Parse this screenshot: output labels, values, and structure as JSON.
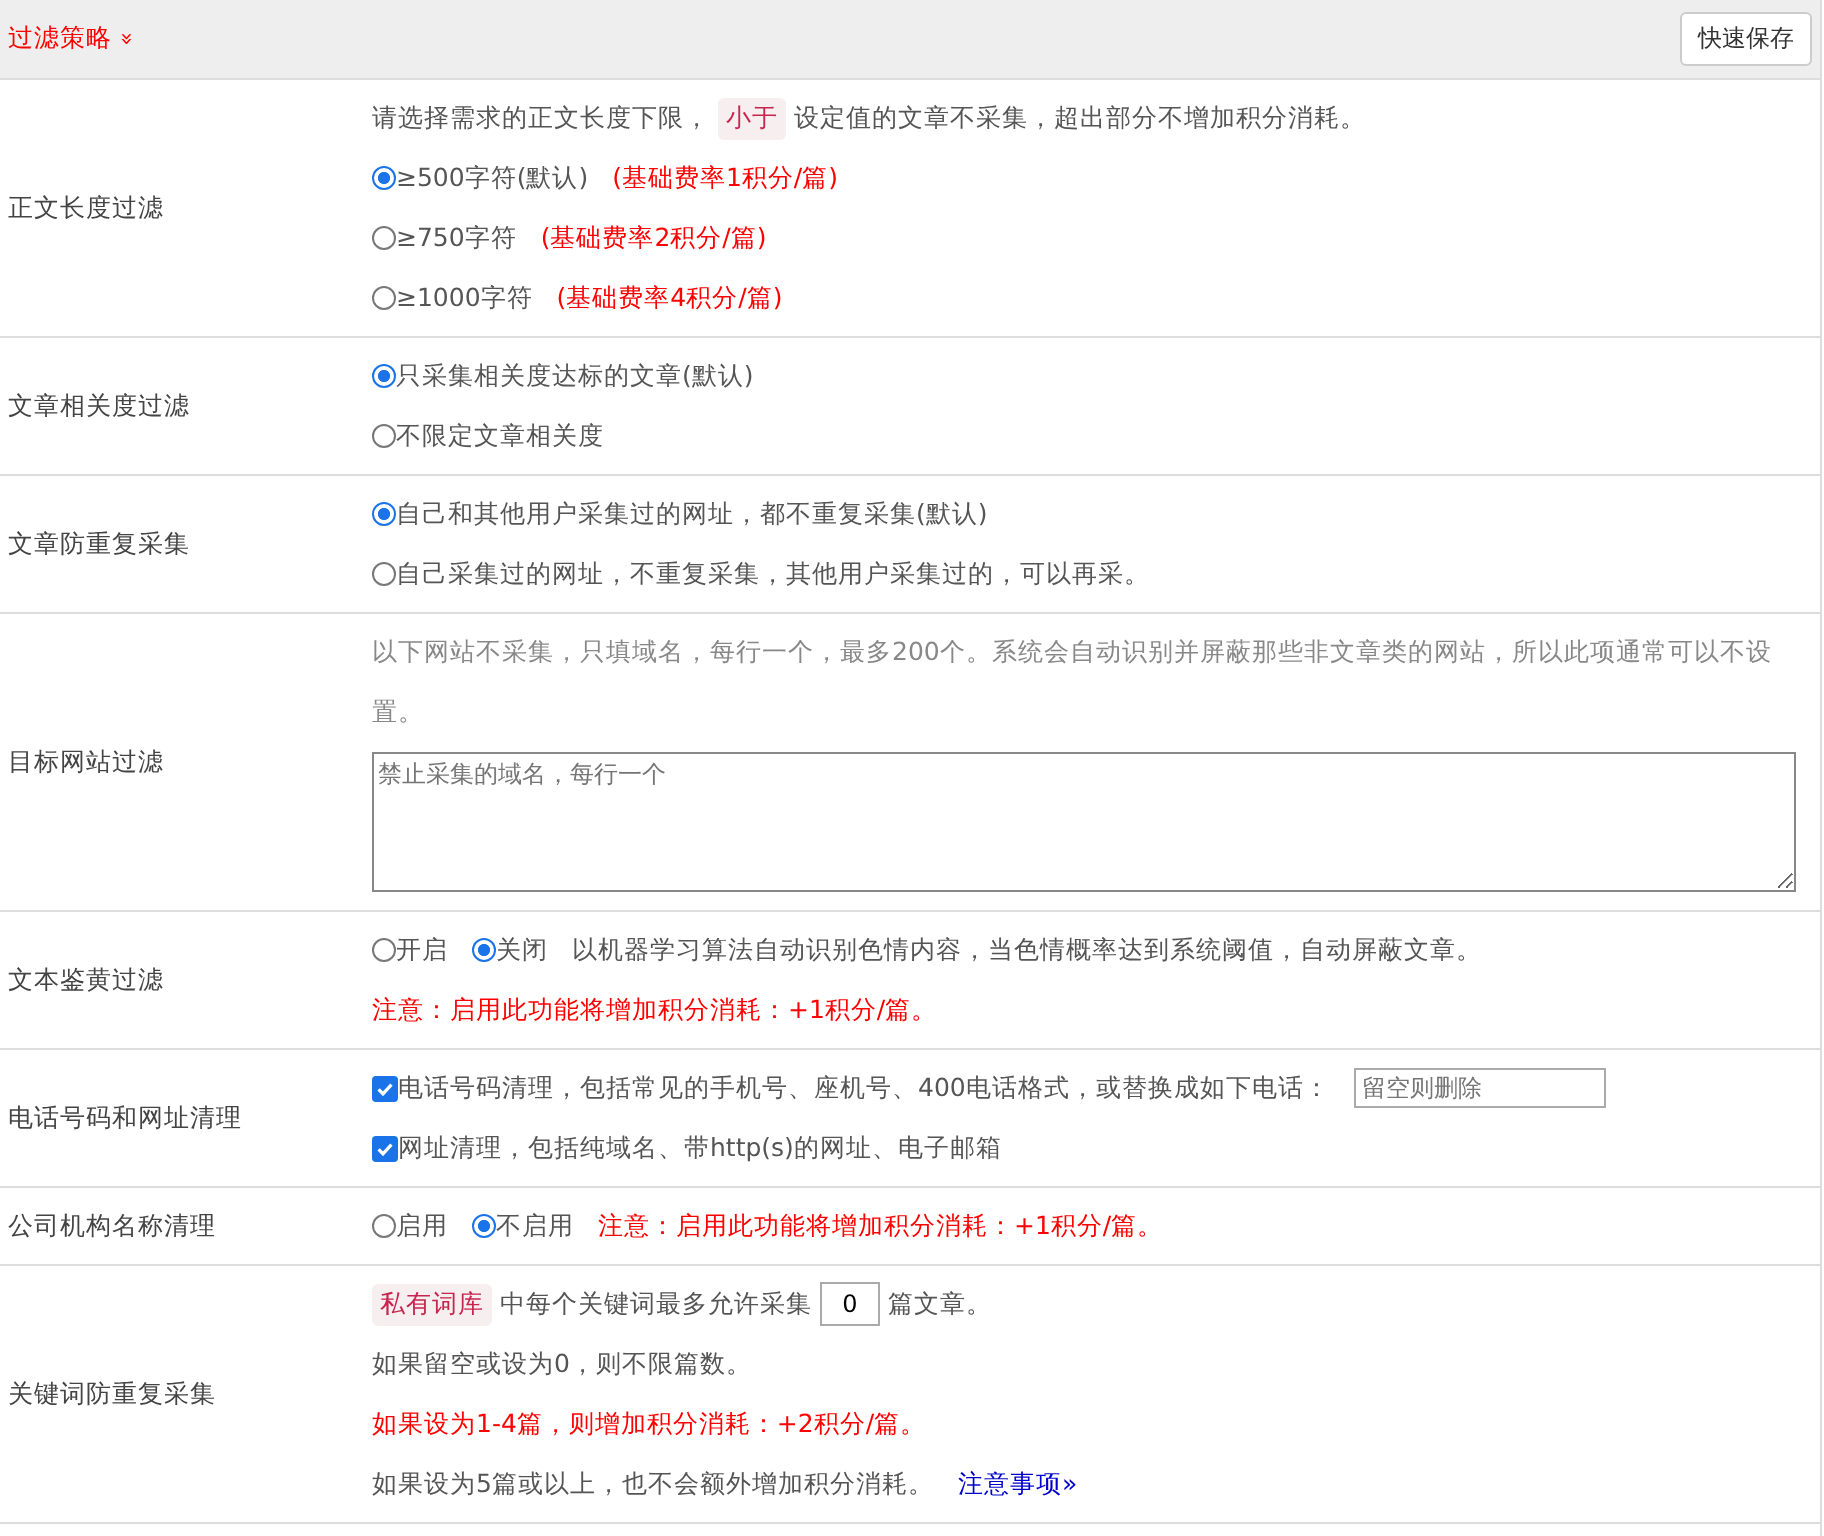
{
  "header": {
    "title": "过滤策略",
    "toggle": "»",
    "save_button": "快速保存"
  },
  "rows": [
    {
      "label": "正文长度过滤",
      "lines": [
        [
          {
            "kind": "text",
            "text": "请选择需求的正文长度下限，"
          },
          {
            "kind": "tag",
            "text": "小于"
          },
          {
            "kind": "text",
            "text": "设定值的文章不采集，超出部分不增加积分消耗。"
          }
        ],
        [
          {
            "kind": "radio",
            "text": "≥500字符(默认)",
            "selected": true
          },
          {
            "kind": "note",
            "text": "(基础费率1积分/篇)"
          }
        ],
        [
          {
            "kind": "radio",
            "text": "≥750字符",
            "selected": false
          },
          {
            "kind": "note",
            "text": "(基础费率2积分/篇)"
          }
        ],
        [
          {
            "kind": "radio",
            "text": "≥1000字符",
            "selected": false
          },
          {
            "kind": "note",
            "text": "(基础费率4积分/篇)"
          }
        ]
      ]
    },
    {
      "label": "文章相关度过滤",
      "lines": [
        [
          {
            "kind": "radio",
            "text": "只采集相关度达标的文章(默认)",
            "selected": true
          }
        ],
        [
          {
            "kind": "radio",
            "text": "不限定文章相关度",
            "selected": false
          }
        ]
      ]
    },
    {
      "label": "文章防重复采集",
      "lines": [
        [
          {
            "kind": "radio",
            "text": "自己和其他用户采集过的网址，都不重复采集(默认)",
            "selected": true
          }
        ],
        [
          {
            "kind": "radio",
            "text": "自己采集过的网址，不重复采集，其他用户采集过的，可以再采。",
            "selected": false
          }
        ]
      ]
    },
    {
      "label": "目标网站过滤",
      "lines": [
        [
          {
            "kind": "muted",
            "text": "以下网站不采集，只填域名，每行一个，最多200个。系统会自动识别并屏蔽那些非文章类的网站，所以此项通常可以不设置。"
          }
        ],
        [
          {
            "kind": "textarea",
            "placeholder": "禁止采集的域名，每行一个"
          }
        ]
      ]
    },
    {
      "label": "文本鉴黄过滤",
      "lines": [
        [
          {
            "kind": "radio",
            "text": "开启",
            "selected": false
          },
          {
            "kind": "radio",
            "text": "关闭",
            "selected": true
          },
          {
            "kind": "text",
            "text": "以机器学习算法自动识别色情内容，当色情概率达到系统阈值，自动屏蔽文章。"
          }
        ],
        [
          {
            "kind": "note",
            "text": "注意：启用此功能将增加积分消耗：+1积分/篇。"
          }
        ]
      ]
    },
    {
      "label": "电话号码和网址清理",
      "lines": [
        [
          {
            "kind": "checkbox",
            "text": "电话号码清理，包括常见的手机号、座机号、400电话格式，或替换成如下电话：",
            "checked": true
          },
          {
            "kind": "input",
            "placeholder": "留空则删除"
          }
        ],
        [
          {
            "kind": "checkbox",
            "text": "网址清理，包括纯域名、带http(s)的网址、电子邮箱",
            "checked": true
          }
        ]
      ]
    },
    {
      "label": "公司机构名称清理",
      "lines": [
        [
          {
            "kind": "radio",
            "text": "启用",
            "selected": false
          },
          {
            "kind": "radio",
            "text": "不启用",
            "selected": true
          },
          {
            "kind": "note",
            "text": "注意：启用此功能将增加积分消耗：+1积分/篇。"
          }
        ]
      ]
    },
    {
      "label": "关键词防重复采集",
      "lines": [
        [
          {
            "kind": "tag",
            "text": "私有词库"
          },
          {
            "kind": "text",
            "text": "中每个关键词最多允许采集"
          },
          {
            "kind": "number",
            "value": "0"
          },
          {
            "kind": "text",
            "text": "篇文章。"
          }
        ],
        [
          {
            "kind": "text",
            "text": "如果留空或设为0，则不限篇数。"
          }
        ],
        [
          {
            "kind": "note",
            "text": "如果设为1-4篇，则增加积分消耗：+2积分/篇。"
          }
        ],
        [
          {
            "kind": "text",
            "text": "如果设为5篇或以上，也不会额外增加积分消耗。"
          },
          {
            "kind": "link",
            "text": "注意事项",
            "caret": "»"
          }
        ]
      ]
    }
  ]
}
